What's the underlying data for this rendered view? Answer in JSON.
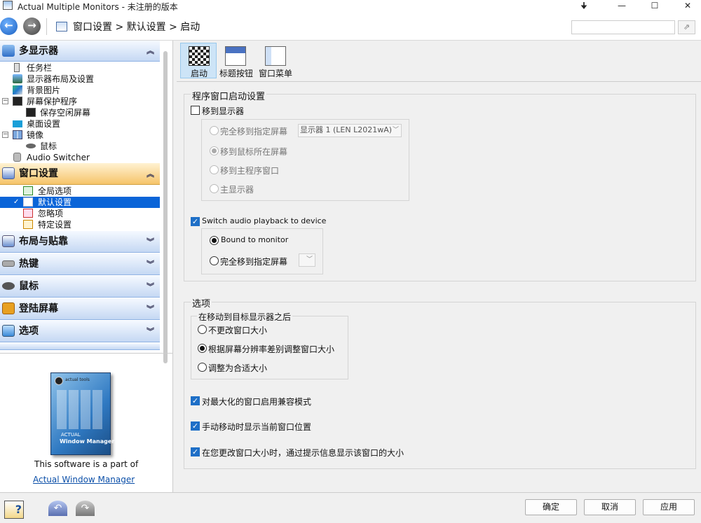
{
  "window": {
    "title": "Actual Multiple Monitors - 未注册的版本",
    "controls": [
      "🠋",
      "—",
      "☐",
      "✕"
    ]
  },
  "nav": {
    "breadcrumb": "窗口设置 > 默认设置 > 启动",
    "search_placeholder": ""
  },
  "sidebar": {
    "multi_display": {
      "label": "多显示器",
      "items": [
        "任务栏",
        "显示器布局及设置",
        "背景图片",
        "屏幕保护程序",
        "保存空闲屏幕",
        "桌面设置",
        "镜像",
        "鼠标",
        "Audio Switcher"
      ]
    },
    "window_settings": {
      "label": "窗口设置",
      "items": [
        "全局选项",
        "默认设置",
        "忽略项",
        "特定设置"
      ]
    },
    "collapsed": [
      "布局与贴靠",
      "热键",
      "鼠标",
      "登陆屏幕",
      "选项"
    ]
  },
  "promo": {
    "text": "This software is a part of",
    "link": "Actual Window Manager",
    "box_brand": "actual tools",
    "box_product": "ACTUAL",
    "box_title": "Window Manager"
  },
  "tabs": [
    "启动",
    "标题按钮",
    "窗口菜单"
  ],
  "startup": {
    "group_title": "程序窗口启动设置",
    "move_to_display": "移到显示器",
    "radios": [
      "完全移到指定屏幕",
      "移到鼠标所在屏幕",
      "移到主程序窗口",
      "主显示器"
    ],
    "monitor_combo": "显示器 1 (LEN L2021wA)",
    "switch_audio": "Switch audio playback to device",
    "audio_radios": [
      "Bound to monitor",
      "完全移到指定屏幕"
    ]
  },
  "options": {
    "group_title": "选项",
    "after_move_title": "在移动到目标显示器之后",
    "after_move": [
      "不更改窗口大小",
      "根据屏幕分辨率差别调整窗口大小",
      "调整为合适大小"
    ],
    "checks": [
      "对最大化的窗口启用兼容模式",
      "手动移动时显示当前窗口位置",
      "在您更改窗口大小时，通过提示信息显示该窗口的大小"
    ]
  },
  "buttons": {
    "ok": "确定",
    "cancel": "取消",
    "apply": "应用"
  },
  "colors": {
    "selection": "#0a64d8",
    "section_blue": "#c5d8f3",
    "section_active": "#f6c46a",
    "link": "#0b4fa8"
  }
}
